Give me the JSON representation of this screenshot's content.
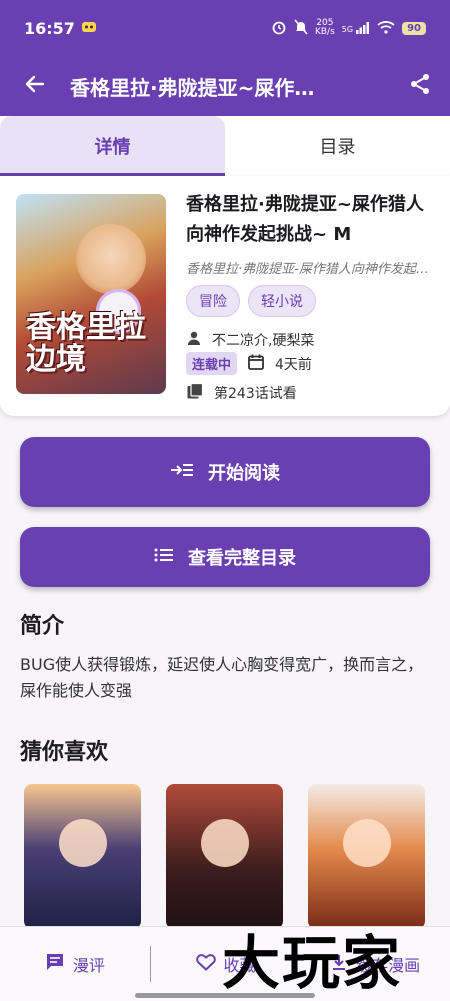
{
  "status_bar": {
    "time": "16:57",
    "net_speed_value": "205",
    "net_speed_unit": "KB/s",
    "signal": "5G",
    "battery": "90"
  },
  "app_bar": {
    "title": "香格里拉·弗陇提亚~屎作…",
    "back_icon": "arrow-left-icon",
    "share_icon": "share-icon"
  },
  "tabs": [
    {
      "label": "详情",
      "active": true
    },
    {
      "label": "目录",
      "active": false
    }
  ],
  "book": {
    "title": "香格里拉·弗陇提亚~屎作猎人向神作发起挑战~ M",
    "subtitle": "香格里拉·弗陇提亚-屎作猎人向神作发起挑战",
    "cover_title": "香格里拉边境",
    "tags": [
      "冒险",
      "轻小说"
    ],
    "author": "不二凉介,硬梨菜",
    "status": "连载中",
    "updated": "4天前",
    "chapter": "第243话试看"
  },
  "actions": {
    "read_label": "开始阅读",
    "catalog_label": "查看完整目录"
  },
  "intro": {
    "heading": "简介",
    "text": "BUG使人获得锻炼，延迟使人心胸变得宽广，换而言之，屎作能使人变强"
  },
  "recommend": {
    "heading": "猜你喜欢",
    "item_count": 3
  },
  "bottom_bar": {
    "comment_label": "漫评",
    "favorite_label": "收藏",
    "cache_label": "缓存漫画"
  },
  "watermark": "大玩家",
  "colors": {
    "primary": "#6a3fb1",
    "primary_light": "#ece4f7",
    "background": "#f7f5fa"
  }
}
